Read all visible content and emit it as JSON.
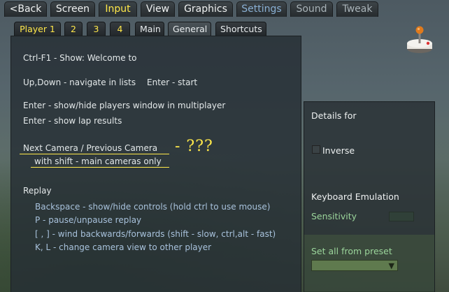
{
  "top_tabs": [
    {
      "label": "<Back"
    },
    {
      "label": "Screen"
    },
    {
      "label": "Input"
    },
    {
      "label": "View"
    },
    {
      "label": "Graphics"
    },
    {
      "label": "Settings"
    },
    {
      "label": "Sound"
    },
    {
      "label": "Tweak"
    }
  ],
  "sub_tabs": [
    {
      "label": "Player 1"
    },
    {
      "label": "2"
    },
    {
      "label": "3"
    },
    {
      "label": "4"
    },
    {
      "label": "Main"
    },
    {
      "label": "General"
    },
    {
      "label": "Shortcuts"
    }
  ],
  "help": {
    "ctrl_f1": "Ctrl-F1 - Show: Welcome to",
    "navigate": "Up,Down - navigate in lists",
    "start": "Enter - start",
    "players_window": "Enter - show/hide players window in multiplayer",
    "lap_results": "Enter - show lap results",
    "camera": "Next Camera / Previous Camera",
    "camera_shift": "with shift - main cameras only",
    "camera_unknown": "- ???",
    "replay_title": "Replay",
    "replay_lines": [
      "Backspace - show/hide controls (hold ctrl to use mouse)",
      "P - pause/unpause replay",
      "[ , ] - wind backwards/forwards (shift - slow, ctrl,alt - fast)",
      "K, L - change camera view to other player"
    ]
  },
  "details": {
    "title": "Details for",
    "inverse": "Inverse",
    "keyboard_emulation": "Keyboard Emulation",
    "sensitivity": "Sensitivity",
    "preset": "Set all from preset",
    "preset_value": ""
  },
  "colors": {
    "active_tab": "#ffe84a",
    "settings_tab": "#8ab0d4",
    "green_label": "#9bd59b"
  },
  "icons": {
    "joystick": "joystick-icon",
    "dropdown_arrow": "chevron-down-icon"
  }
}
